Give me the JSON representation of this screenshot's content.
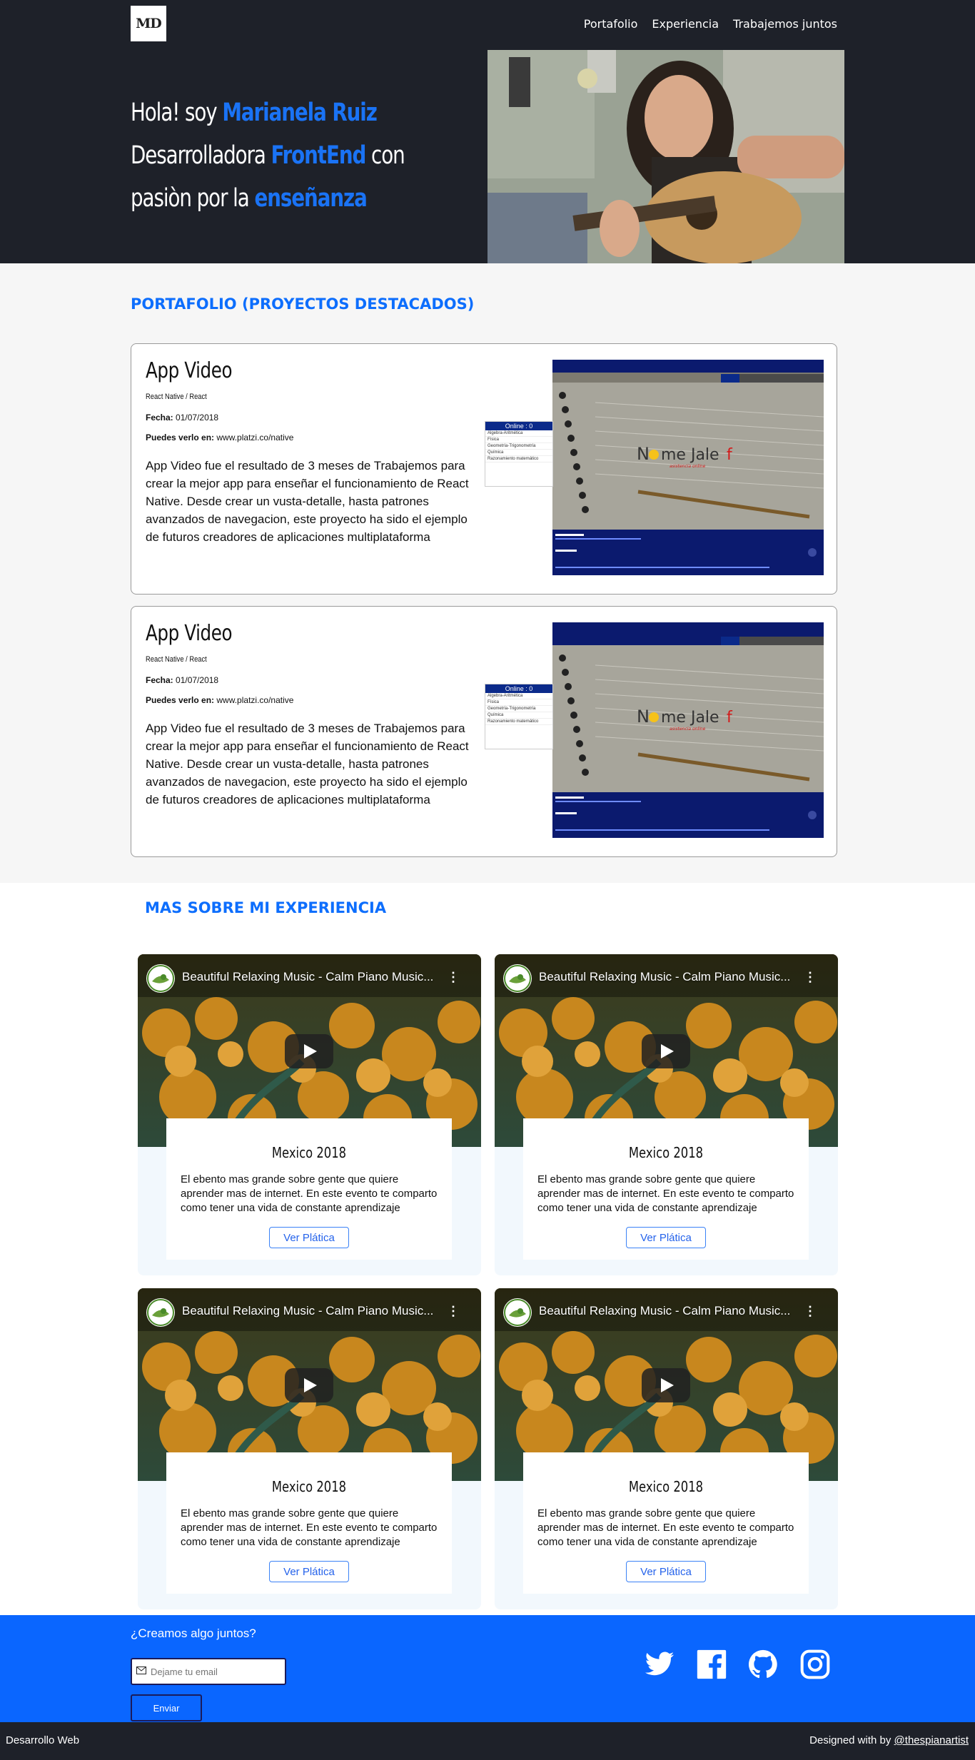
{
  "header": {
    "logo_text": "MD",
    "nav": [
      "Portafolio",
      "Experiencia",
      "Trabajemos juntos"
    ]
  },
  "hero": {
    "line1_a": "Hola! soy ",
    "line1_hl": "Marianela Ruiz",
    "line2_a": "Desarrolladora ",
    "line2_hl": "FrontEnd",
    "line2_b": " con",
    "line3_a": "pasiòn por la ",
    "line3_hl": "enseñanza"
  },
  "portfolio": {
    "title": "PORTAFOLIO (PROYECTOS DESTACADOS)",
    "cards": [
      {
        "name": "App Video",
        "tech": "React Native / React",
        "date_label": "Fecha:",
        "date": "01/07/2018",
        "site_label": "Puedes verlo en:",
        "site": "www.platzi.co/native",
        "description": "App Video fue el resultado de 3 meses de Trabajemos para crear la mejor app para enseñar el funcionamiento de React Native. Desde crear un vusta-detalle, hasta patrones avanzados de navegacion, este proyecto ha sido el ejemplo de futuros creadores de aplicaciones multiplataforma",
        "online_label": "Online : 0",
        "online_items": [
          "Algebra-Aritmética",
          "Física",
          "Geometría-Trigonometría",
          "Química",
          "Razonamiento matemático"
        ],
        "shot_logo": "No me Jalef",
        "shot_tag": "asistencia online"
      },
      {
        "name": "App Video",
        "tech": "React Native / React",
        "date_label": "Fecha:",
        "date": "01/07/2018",
        "site_label": "Puedes verlo en:",
        "site": "www.platzi.co/native",
        "description": "App Video fue el resultado de 3 meses de Trabajemos para crear la mejor app para enseñar el funcionamiento de React Native. Desde crear un vusta-detalle, hasta patrones avanzados de navegacion, este proyecto ha sido el ejemplo de futuros creadores de aplicaciones multiplataforma",
        "online_label": "Online : 0",
        "online_items": [
          "Algebra-Aritmética",
          "Física",
          "Geometría-Trigonometría",
          "Química",
          "Razonamiento matemático"
        ],
        "shot_logo": "No me Jalef",
        "shot_tag": "asistencia online"
      }
    ]
  },
  "experience": {
    "title": "MAS SOBRE MI EXPERIENCIA",
    "cards": [
      {
        "video_title": "Beautiful Relaxing Music - Calm Piano Music...",
        "event": "Mexico 2018",
        "text": "El ebento mas grande sobre gente que quiere aprender mas de internet. En este evento te comparto como tener una vida de constante aprendizaje",
        "button": "Ver Plática"
      },
      {
        "video_title": "Beautiful Relaxing Music - Calm Piano Music...",
        "event": "Mexico 2018",
        "text": "El ebento mas grande sobre gente que quiere aprender mas de internet. En este evento te comparto como tener una vida de constante aprendizaje",
        "button": "Ver Plática"
      },
      {
        "video_title": "Beautiful Relaxing Music - Calm Piano Music...",
        "event": "Mexico 2018",
        "text": "El ebento mas grande sobre gente que quiere aprender mas de internet. En este evento te comparto como tener una vida de constante aprendizaje",
        "button": "Ver Plática"
      },
      {
        "video_title": "Beautiful Relaxing Music - Calm Piano Music...",
        "event": "Mexico 2018",
        "text": "El ebento mas grande sobre gente que quiere aprender mas de internet. En este evento te comparto como tener una vida de constante aprendizaje",
        "button": "Ver Plática"
      }
    ]
  },
  "contact": {
    "title": "¿Creamos algo juntos?",
    "email_placeholder": "Dejame tu email",
    "send_label": "Enviar",
    "social_icons": [
      "twitter-icon",
      "facebook-icon",
      "github-icon",
      "instagram-icon"
    ]
  },
  "bottom": {
    "left": "Desarrollo Web",
    "right_prefix": "Designed with by ",
    "right_link": "@thespianartist"
  },
  "colors": {
    "accent": "#1a73f5",
    "dark": "#1e2129",
    "footer_blue": "#0a66ff"
  }
}
